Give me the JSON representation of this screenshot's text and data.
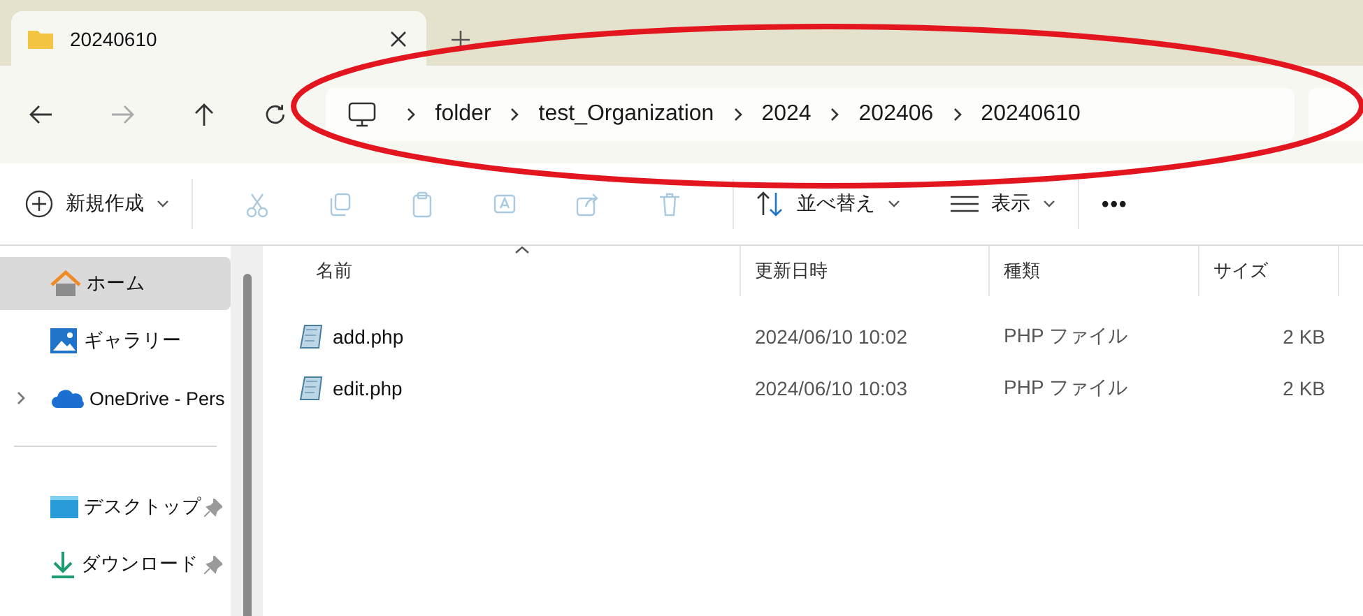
{
  "tabs": [
    {
      "title": "20240610",
      "selected": true
    }
  ],
  "breadcrumb": [
    "folder",
    "test_Organization",
    "2024",
    "202406",
    "20240610"
  ],
  "toolbar": {
    "new_label": "新規作成",
    "actions": [
      {
        "kind": "cut",
        "disabled": true
      },
      {
        "kind": "copy",
        "disabled": true
      },
      {
        "kind": "paste",
        "disabled": true
      },
      {
        "kind": "rename",
        "disabled": true
      },
      {
        "kind": "share",
        "disabled": true
      },
      {
        "kind": "delete",
        "disabled": true
      }
    ],
    "sort_label": "並べ替え",
    "view_label": "表示",
    "more": "•••"
  },
  "sidebar": {
    "groups": [
      [
        {
          "label": "ホーム",
          "kind": "home",
          "selected": true,
          "expandable": false,
          "pinned": false
        },
        {
          "label": "ギャラリー",
          "kind": "gallery",
          "selected": false,
          "expandable": false,
          "pinned": false
        },
        {
          "label": "OneDrive - Pers",
          "kind": "cloud",
          "selected": false,
          "expandable": true,
          "pinned": false
        }
      ],
      [
        {
          "label": "デスクトップ",
          "kind": "desktop",
          "selected": false,
          "expandable": false,
          "pinned": true
        },
        {
          "label": "ダウンロード",
          "kind": "download",
          "selected": false,
          "expandable": false,
          "pinned": true
        }
      ]
    ]
  },
  "table": {
    "columns": [
      {
        "label": "名前",
        "sorted": true
      },
      {
        "label": "更新日時",
        "sorted": false
      },
      {
        "label": "種類",
        "sorted": false
      },
      {
        "label": "サイズ",
        "sorted": false
      }
    ],
    "rows": [
      {
        "name": "add.php",
        "modified": "2024/06/10 10:02",
        "type": "PHP ファイル",
        "size": "2 KB"
      },
      {
        "name": "edit.php",
        "modified": "2024/06/10 10:03",
        "type": "PHP ファイル",
        "size": "2 KB"
      }
    ]
  },
  "annotation": {
    "kind": "ellipse",
    "color": "#e3161f"
  }
}
